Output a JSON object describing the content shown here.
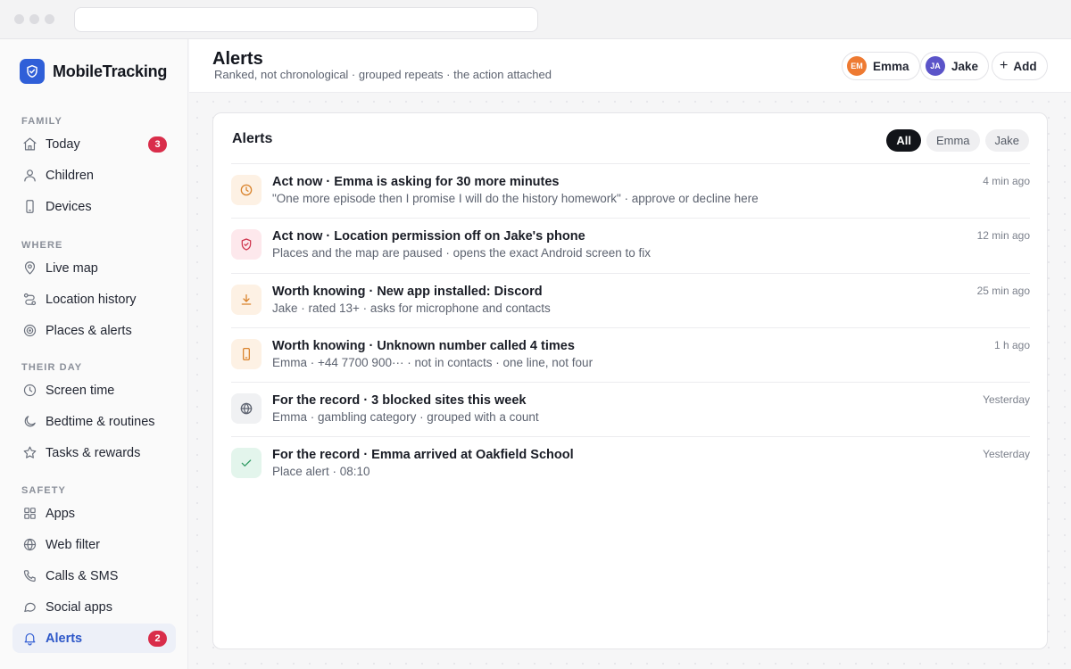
{
  "brand": {
    "name": "MobileTracking",
    "icon": "shield-check-icon",
    "color": "#2f5fd8"
  },
  "sidebar": {
    "sections": [
      {
        "label": "FAMILY",
        "items": [
          {
            "label": "Today",
            "icon": "home-icon",
            "badge": "3"
          },
          {
            "label": "Children",
            "icon": "user-icon"
          },
          {
            "label": "Devices",
            "icon": "phone-icon"
          }
        ]
      },
      {
        "label": "WHERE",
        "items": [
          {
            "label": "Live map",
            "icon": "map-pin-icon"
          },
          {
            "label": "Location history",
            "icon": "route-icon"
          },
          {
            "label": "Places & alerts",
            "icon": "target-icon"
          }
        ]
      },
      {
        "label": "THEIR DAY",
        "items": [
          {
            "label": "Screen time",
            "icon": "clock-icon"
          },
          {
            "label": "Bedtime & routines",
            "icon": "moon-icon"
          },
          {
            "label": "Tasks & rewards",
            "icon": "star-icon"
          }
        ]
      },
      {
        "label": "SAFETY",
        "items": [
          {
            "label": "Apps",
            "icon": "grid-icon"
          },
          {
            "label": "Web filter",
            "icon": "globe-icon"
          },
          {
            "label": "Calls & SMS",
            "icon": "phone-call-icon"
          },
          {
            "label": "Social apps",
            "icon": "chat-icon"
          },
          {
            "label": "Alerts",
            "icon": "bell-icon",
            "badge": "2",
            "active": true
          }
        ]
      }
    ]
  },
  "header": {
    "title": "Alerts",
    "subtitle": "Ranked, not chronological · grouped repeats · the action attached",
    "children": [
      {
        "name": "Emma",
        "initials": "EM",
        "color": "#ee7a32"
      },
      {
        "name": "Jake",
        "initials": "JA",
        "color": "#5b54c9"
      }
    ],
    "add_label": "Add"
  },
  "card": {
    "title": "Alerts",
    "filters": [
      {
        "label": "All",
        "active": true
      },
      {
        "label": "Emma"
      },
      {
        "label": "Jake"
      }
    ],
    "alerts": [
      {
        "icon": "clock-icon",
        "tone": "orange",
        "title": "Act now · Emma is asking for 30 more minutes",
        "detail": "\"One more episode then I promise I will do the history homework\" · approve or decline here",
        "time": "4 min ago"
      },
      {
        "icon": "shield-alert-icon",
        "tone": "red",
        "title": "Act now · Location permission off on Jake's phone",
        "detail": "Places and the map are paused · opens the exact Android screen to fix",
        "time": "12 min ago"
      },
      {
        "icon": "download-icon",
        "tone": "orange",
        "title": "Worth knowing · New app installed: Discord",
        "detail": "Jake · rated 13+ · asks for microphone and contacts",
        "time": "25 min ago"
      },
      {
        "icon": "phone-icon",
        "tone": "orange",
        "title": "Worth knowing · Unknown number called 4 times",
        "detail": "Emma · +44 7700 900··· · not in contacts · one line, not four",
        "time": "1 h ago"
      },
      {
        "icon": "globe-icon",
        "tone": "gray",
        "title": "For the record · 3 blocked sites this week",
        "detail": "Emma · gambling category · grouped with a count",
        "time": "Yesterday"
      },
      {
        "icon": "check-icon",
        "tone": "green",
        "title": "For the record · Emma arrived at Oakfield School",
        "detail": "Place alert · 08:10",
        "time": "Yesterday"
      }
    ]
  },
  "colors": {
    "accent": "#2f5fd8",
    "badge": "#d92d4a",
    "tone_orange_bg": "#fdf1e4",
    "tone_orange_fg": "#d9822b",
    "tone_red_bg": "#fde8ec",
    "tone_red_fg": "#d0364f",
    "tone_gray_bg": "#f0f1f3",
    "tone_gray_fg": "#5d6370",
    "tone_green_bg": "#e3f5ec",
    "tone_green_fg": "#2f9a62"
  }
}
